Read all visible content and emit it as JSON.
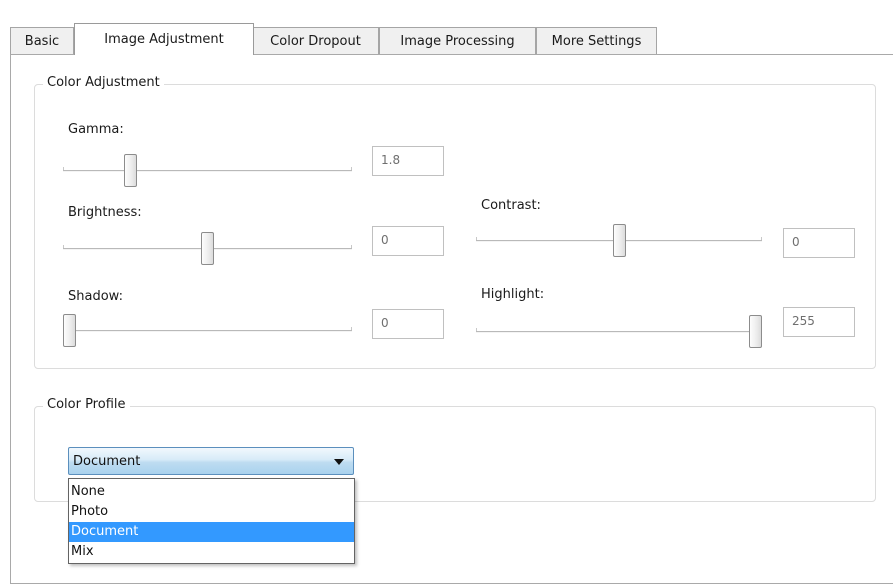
{
  "tabs": [
    {
      "label": "Basic",
      "active": false
    },
    {
      "label": "Image Adjustment",
      "active": true
    },
    {
      "label": "Color Dropout",
      "active": false
    },
    {
      "label": "Image Processing",
      "active": false
    },
    {
      "label": "More Settings",
      "active": false
    }
  ],
  "color_adjustment": {
    "title": "Color Adjustment",
    "gamma": {
      "label": "Gamma:",
      "value": "1.8",
      "level": 0.22
    },
    "brightness": {
      "label": "Brightness:",
      "value": "0",
      "level": 0.5
    },
    "contrast": {
      "label": "Contrast:",
      "value": "0",
      "level": 0.5
    },
    "shadow": {
      "label": "Shadow:",
      "value": "0",
      "level": 0.0
    },
    "highlight": {
      "label": "Highlight:",
      "value": "255",
      "level": 1.0
    }
  },
  "color_profile": {
    "title": "Color Profile",
    "selected": "Document",
    "options": [
      "None",
      "Photo",
      "Document",
      "Mix"
    ],
    "highlighted_option": "Document"
  },
  "colors": {
    "selection": "#3399ff",
    "combo_border": "#5b8fbd"
  },
  "icons": {
    "dropdown": "chevron-down-icon"
  }
}
